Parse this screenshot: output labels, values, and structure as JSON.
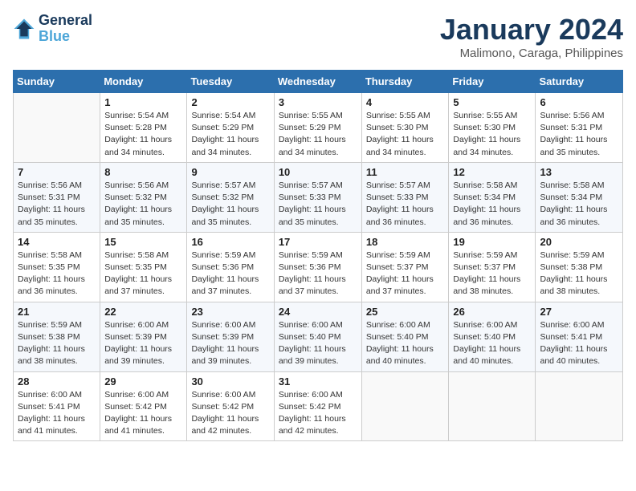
{
  "logo": {
    "line1": "General",
    "line2": "Blue"
  },
  "title": "January 2024",
  "subtitle": "Malimono, Caraga, Philippines",
  "days_header": [
    "Sunday",
    "Monday",
    "Tuesday",
    "Wednesday",
    "Thursday",
    "Friday",
    "Saturday"
  ],
  "weeks": [
    [
      {
        "num": "",
        "info": ""
      },
      {
        "num": "1",
        "info": "Sunrise: 5:54 AM\nSunset: 5:28 PM\nDaylight: 11 hours\nand 34 minutes."
      },
      {
        "num": "2",
        "info": "Sunrise: 5:54 AM\nSunset: 5:29 PM\nDaylight: 11 hours\nand 34 minutes."
      },
      {
        "num": "3",
        "info": "Sunrise: 5:55 AM\nSunset: 5:29 PM\nDaylight: 11 hours\nand 34 minutes."
      },
      {
        "num": "4",
        "info": "Sunrise: 5:55 AM\nSunset: 5:30 PM\nDaylight: 11 hours\nand 34 minutes."
      },
      {
        "num": "5",
        "info": "Sunrise: 5:55 AM\nSunset: 5:30 PM\nDaylight: 11 hours\nand 34 minutes."
      },
      {
        "num": "6",
        "info": "Sunrise: 5:56 AM\nSunset: 5:31 PM\nDaylight: 11 hours\nand 35 minutes."
      }
    ],
    [
      {
        "num": "7",
        "info": "Sunrise: 5:56 AM\nSunset: 5:31 PM\nDaylight: 11 hours\nand 35 minutes."
      },
      {
        "num": "8",
        "info": "Sunrise: 5:56 AM\nSunset: 5:32 PM\nDaylight: 11 hours\nand 35 minutes."
      },
      {
        "num": "9",
        "info": "Sunrise: 5:57 AM\nSunset: 5:32 PM\nDaylight: 11 hours\nand 35 minutes."
      },
      {
        "num": "10",
        "info": "Sunrise: 5:57 AM\nSunset: 5:33 PM\nDaylight: 11 hours\nand 35 minutes."
      },
      {
        "num": "11",
        "info": "Sunrise: 5:57 AM\nSunset: 5:33 PM\nDaylight: 11 hours\nand 36 minutes."
      },
      {
        "num": "12",
        "info": "Sunrise: 5:58 AM\nSunset: 5:34 PM\nDaylight: 11 hours\nand 36 minutes."
      },
      {
        "num": "13",
        "info": "Sunrise: 5:58 AM\nSunset: 5:34 PM\nDaylight: 11 hours\nand 36 minutes."
      }
    ],
    [
      {
        "num": "14",
        "info": "Sunrise: 5:58 AM\nSunset: 5:35 PM\nDaylight: 11 hours\nand 36 minutes."
      },
      {
        "num": "15",
        "info": "Sunrise: 5:58 AM\nSunset: 5:35 PM\nDaylight: 11 hours\nand 37 minutes."
      },
      {
        "num": "16",
        "info": "Sunrise: 5:59 AM\nSunset: 5:36 PM\nDaylight: 11 hours\nand 37 minutes."
      },
      {
        "num": "17",
        "info": "Sunrise: 5:59 AM\nSunset: 5:36 PM\nDaylight: 11 hours\nand 37 minutes."
      },
      {
        "num": "18",
        "info": "Sunrise: 5:59 AM\nSunset: 5:37 PM\nDaylight: 11 hours\nand 37 minutes."
      },
      {
        "num": "19",
        "info": "Sunrise: 5:59 AM\nSunset: 5:37 PM\nDaylight: 11 hours\nand 38 minutes."
      },
      {
        "num": "20",
        "info": "Sunrise: 5:59 AM\nSunset: 5:38 PM\nDaylight: 11 hours\nand 38 minutes."
      }
    ],
    [
      {
        "num": "21",
        "info": "Sunrise: 5:59 AM\nSunset: 5:38 PM\nDaylight: 11 hours\nand 38 minutes."
      },
      {
        "num": "22",
        "info": "Sunrise: 6:00 AM\nSunset: 5:39 PM\nDaylight: 11 hours\nand 39 minutes."
      },
      {
        "num": "23",
        "info": "Sunrise: 6:00 AM\nSunset: 5:39 PM\nDaylight: 11 hours\nand 39 minutes."
      },
      {
        "num": "24",
        "info": "Sunrise: 6:00 AM\nSunset: 5:40 PM\nDaylight: 11 hours\nand 39 minutes."
      },
      {
        "num": "25",
        "info": "Sunrise: 6:00 AM\nSunset: 5:40 PM\nDaylight: 11 hours\nand 40 minutes."
      },
      {
        "num": "26",
        "info": "Sunrise: 6:00 AM\nSunset: 5:40 PM\nDaylight: 11 hours\nand 40 minutes."
      },
      {
        "num": "27",
        "info": "Sunrise: 6:00 AM\nSunset: 5:41 PM\nDaylight: 11 hours\nand 40 minutes."
      }
    ],
    [
      {
        "num": "28",
        "info": "Sunrise: 6:00 AM\nSunset: 5:41 PM\nDaylight: 11 hours\nand 41 minutes."
      },
      {
        "num": "29",
        "info": "Sunrise: 6:00 AM\nSunset: 5:42 PM\nDaylight: 11 hours\nand 41 minutes."
      },
      {
        "num": "30",
        "info": "Sunrise: 6:00 AM\nSunset: 5:42 PM\nDaylight: 11 hours\nand 42 minutes."
      },
      {
        "num": "31",
        "info": "Sunrise: 6:00 AM\nSunset: 5:42 PM\nDaylight: 11 hours\nand 42 minutes."
      },
      {
        "num": "",
        "info": ""
      },
      {
        "num": "",
        "info": ""
      },
      {
        "num": "",
        "info": ""
      }
    ]
  ]
}
